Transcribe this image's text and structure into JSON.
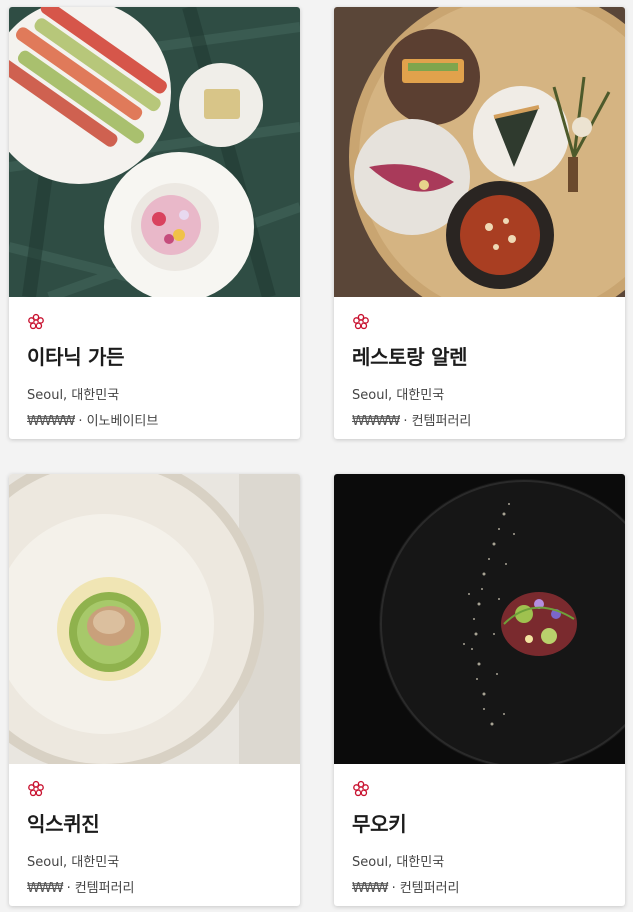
{
  "restaurants": [
    {
      "name": "이타닉 가든",
      "location": "Seoul, 대한민국",
      "price": "₩₩₩₩",
      "separator": "·",
      "cuisine": "이노베이티브",
      "award_icon": "michelin-star-icon",
      "photo_icon": "plated-rhubarb-dish-photo"
    },
    {
      "name": "레스토랑 알렌",
      "location": "Seoul, 대한민국",
      "price": "₩₩₩₩",
      "separator": "·",
      "cuisine": "컨템퍼러리",
      "award_icon": "michelin-star-icon",
      "photo_icon": "tasting-course-tray-photo"
    },
    {
      "name": "익스퀴진",
      "location": "Seoul, 대한민국",
      "price": "₩₩₩",
      "separator": "·",
      "cuisine": "컨템퍼러리",
      "award_icon": "michelin-star-icon",
      "photo_icon": "abalone-on-zucchini-photo"
    },
    {
      "name": "무오키",
      "location": "Seoul, 대한민국",
      "price": "₩₩₩",
      "separator": "·",
      "cuisine": "컨템퍼러리",
      "award_icon": "michelin-star-icon",
      "photo_icon": "dark-plate-garnish-photo"
    }
  ],
  "colors": {
    "star": "#c8102e",
    "background": "#f3f3f3",
    "card": "#ffffff"
  }
}
